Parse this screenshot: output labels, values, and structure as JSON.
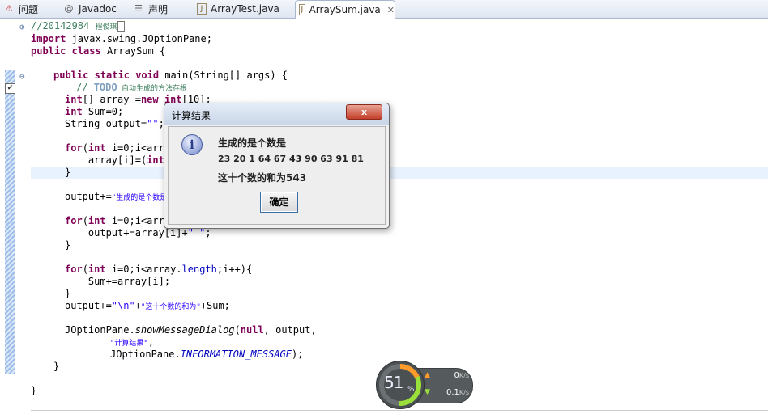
{
  "tabs": [
    {
      "label": "问题",
      "icon": "problems-icon"
    },
    {
      "label": "Javadoc",
      "icon": "at-icon"
    },
    {
      "label": "声明",
      "icon": "declaration-icon"
    },
    {
      "label": "ArrayTest.java",
      "icon": "java-file-icon"
    },
    {
      "label": "ArraySum.java",
      "icon": "java-file-icon",
      "active": true
    }
  ],
  "code": {
    "l1_comment": "//20142984 ",
    "l1_name": "程俊琪",
    "l2_kw": "import",
    "l2_rest": " javax.swing.JOptionPane;",
    "l3_kw1": "public",
    "l3_kw2": "class",
    "l3_rest": " ArraySum {",
    "l5_kw1": "public",
    "l5_kw2": "static",
    "l5_kw3": "void",
    "l5_rest": " main(String[] args) {",
    "l6_comment": "// ",
    "l6_todo": "TODO",
    "l6_cn": " 自动生成的方法存根",
    "l7_kw1": "int",
    "l7_mid": "[] array =",
    "l7_kw2": "new",
    "l7_sp": " ",
    "l7_kw3": "int",
    "l7_rest": "[10];",
    "l8_kw": "int",
    "l8_rest": " Sum=0;",
    "l9_text": "String output=",
    "l9_str": "\"\"",
    "l9_end": ";",
    "l11_kw1": "for",
    "l11_p": "(",
    "l11_kw2": "int",
    "l11_rest": " i=0;i<arra",
    "l12_text": "    array[i]=(",
    "l12_kw": "int",
    "l13_text": "}",
    "l15_text": "output+=",
    "l15_str": "\"生成的是个数是",
    "l17_kw1": "for",
    "l17_p": "(",
    "l17_kw2": "int",
    "l17_rest": " i=0;i<arra",
    "l18_text": "    output+=array[i]+",
    "l18_str": "\" \"",
    "l18_end": ";",
    "l19_text": "}",
    "l21_kw1": "for",
    "l21_p": "(",
    "l21_kw2": "int",
    "l21_mid": " i=0;i<array.",
    "l21_fld": "length",
    "l21_rest": ";i++){",
    "l22_text": "    Sum+=array[i];",
    "l23_text": "}",
    "l24_a": "output+=",
    "l24_s1": "\"\\n\"",
    "l24_b": "+",
    "l24_s2": "\"这十个数的和为\"",
    "l24_c": "+Sum;",
    "l26_a": "JOptionPane.",
    "l26_m": "showMessageDialog",
    "l26_b": "(",
    "l26_kw": "null",
    "l26_c": ", output,",
    "l27_str": "\"计算结果\"",
    "l27_end": ",",
    "l28_a": "JOptionPane.",
    "l28_f": "INFORMATION_MESSAGE",
    "l28_b": ");",
    "l29_text": "}",
    "l31_text": "}"
  },
  "dialog": {
    "title": "计算结果",
    "close": "x",
    "line1": "生成的是个数是",
    "line2": "23 20 1 64 67 43 90 63 91 81",
    "line3": "这十个数的和为543",
    "ok": "确定",
    "icon": "info-icon"
  },
  "netmon": {
    "percent": "51",
    "percent_sign": "%",
    "upload": "0",
    "upload_unit": "K/s",
    "download": "0.1",
    "download_unit": "K/s",
    "upload_color": "#ff9b2b",
    "download_color": "#9adf3a"
  }
}
